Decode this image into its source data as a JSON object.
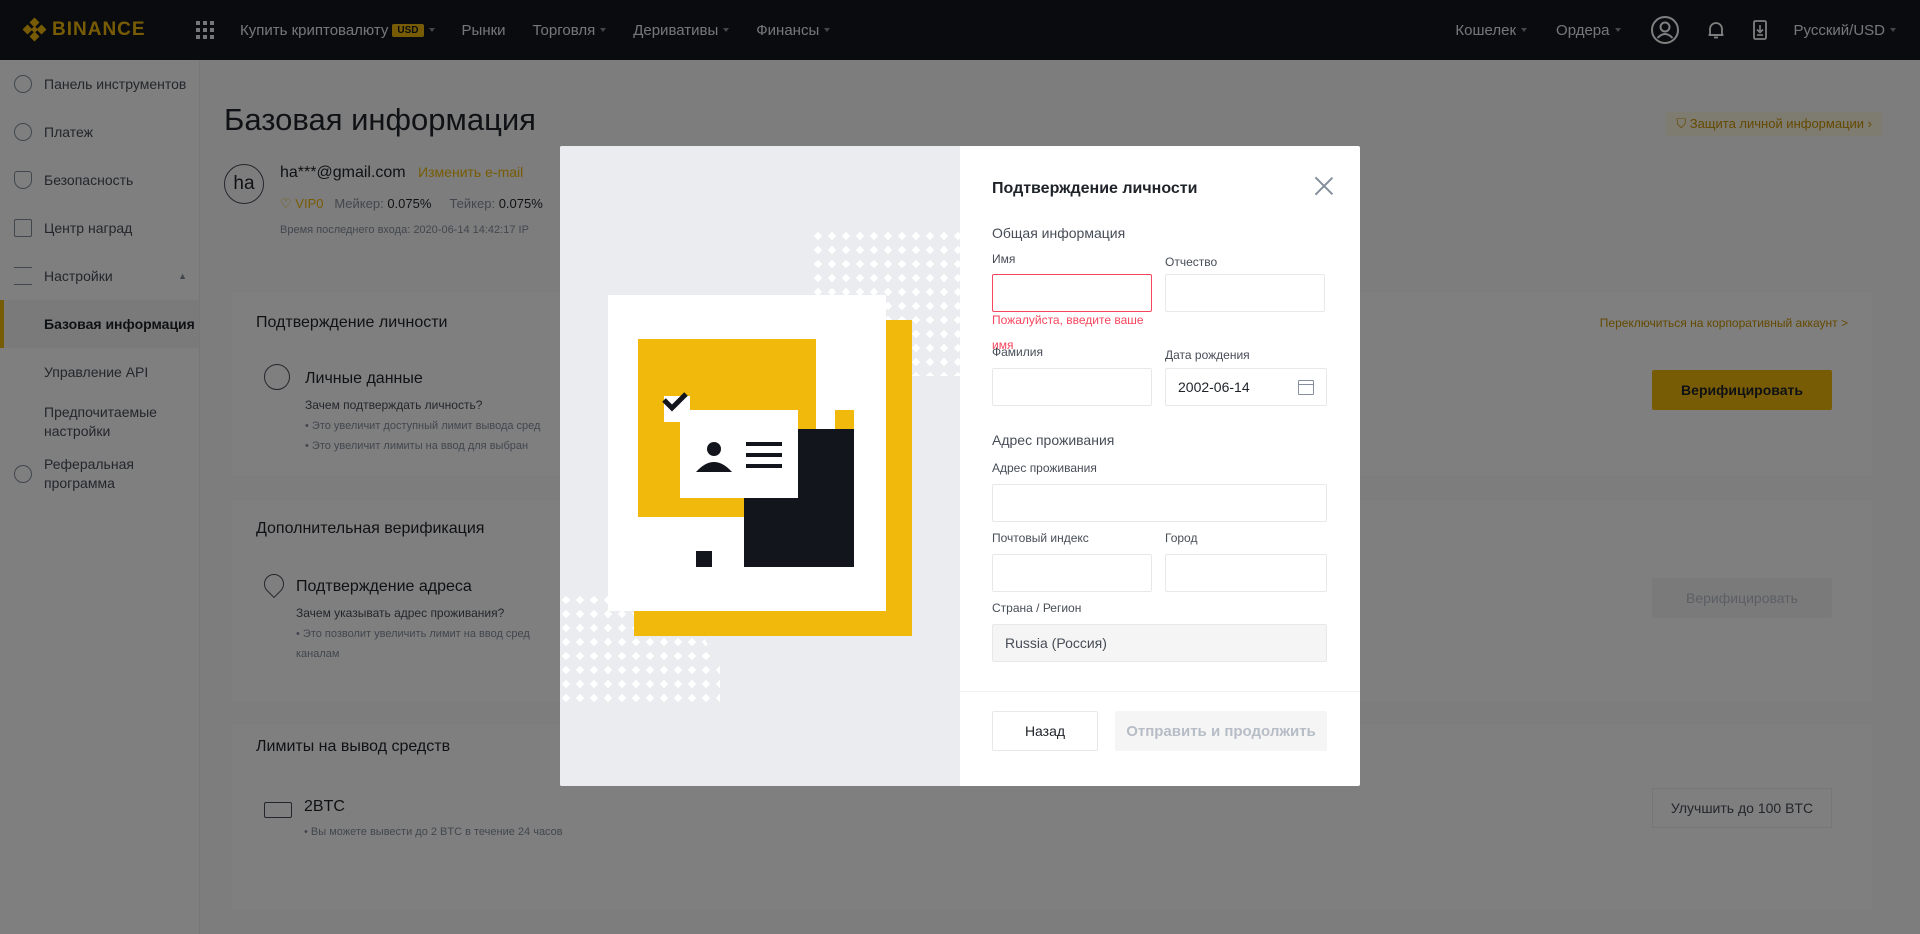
{
  "brand": {
    "name": "BINANCE"
  },
  "topnav": {
    "buy_crypto": "Купить криптовалюту",
    "buy_badge": "USD",
    "markets": "Рынки",
    "trade": "Торговля",
    "derivatives": "Деривативы",
    "finance": "Финансы",
    "wallet": "Кошелек",
    "orders": "Ордера",
    "language": "Русский/USD"
  },
  "sidebar": {
    "items": [
      {
        "label": "Панель инструментов",
        "icon": "user-icon"
      },
      {
        "label": "Платеж",
        "icon": "dollar-icon"
      },
      {
        "label": "Безопасность",
        "icon": "shield-icon"
      },
      {
        "label": "Центр наград",
        "icon": "gift-icon"
      },
      {
        "label": "Настройки",
        "icon": "sliders-icon"
      }
    ],
    "sub_items": [
      {
        "label": "Базовая информация"
      },
      {
        "label": "Управление API"
      },
      {
        "label": "Предпочитаемые настройки"
      }
    ],
    "referral": "Реферальная программа"
  },
  "main": {
    "title": "Базовая информация",
    "protect_link": "Защита личной информации",
    "avatar": "ha",
    "email": "ha***@gmail.com",
    "change_email": "Изменить e-mail",
    "vip": "VIP0",
    "maker_label": "Мейкер:",
    "maker_value": "0.075%",
    "taker_label": "Тейкер:",
    "taker_value": "0.075%",
    "last_login": "Время последнего входа: 2020-06-14 14:42:17  IP"
  },
  "identity_card": {
    "title": "Подтверждение личности",
    "switch_link": "Переключиться на корпоративный аккаунт >",
    "personal_title": "Личные данные",
    "personal_question": "Зачем подтверждать личность?",
    "personal_note1": "• Это увеличит доступный лимит вывода сред",
    "personal_note2": "• Это увеличит лимиты на ввод для выбран",
    "verify_button": "Верифицировать"
  },
  "additional_card": {
    "title": "Дополнительная верификация",
    "address_title": "Подтверждение адреса",
    "address_question": "Зачем указывать адрес проживания?",
    "address_note1": "• Это позволит увеличить лимит на ввод сред",
    "address_note2": "каналам",
    "verify_button": "Верифицировать"
  },
  "limits_card": {
    "title": "Лимиты на вывод средств",
    "amount": "2BTC",
    "note": "• Вы можете вывести до 2 BTC в течение 24 часов",
    "upgrade_button": "Улучшить до 100 BTC"
  },
  "modal": {
    "title": "Подтверждение личности",
    "general_section": "Общая информация",
    "first_name_label": "Имя",
    "first_name_value": "",
    "middle_name_label": "Отчество",
    "middle_name_value": "",
    "error_message": "Пожалуйста, введите ваше имя",
    "last_name_label": "Фамилия",
    "last_name_value": "",
    "birth_date_label": "Дата рождения",
    "birth_date_value": "2002-06-14",
    "address_section": "Адрес проживания",
    "address_label": "Адрес проживания",
    "address_value": "",
    "postal_label": "Почтовый индекс",
    "postal_value": "",
    "city_label": "Город",
    "city_value": "",
    "country_label": "Страна / Регион",
    "country_value": "Russia (Россия)",
    "back_button": "Назад",
    "submit_button": "Отправить и продолжить"
  },
  "colors": {
    "accent": "#f0b90b",
    "nav_bg": "#12161c",
    "error": "#f6465d"
  }
}
